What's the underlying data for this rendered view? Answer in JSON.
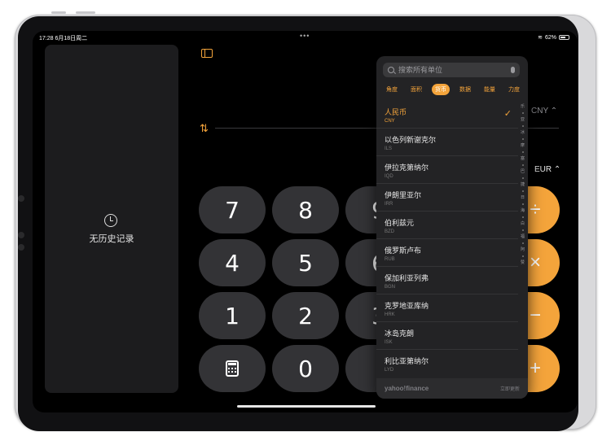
{
  "status": {
    "time": "17:28",
    "date": "6月18日周二",
    "battery": "62%",
    "dots": "•••"
  },
  "history": {
    "empty_text": "无历史记录"
  },
  "converter": {
    "from_unit": "CNY",
    "to_unit": "EUR",
    "accent_color": "#f4a43b"
  },
  "keypad": {
    "keys": [
      "7",
      "8",
      "9",
      "4",
      "5",
      "6",
      "1",
      "2",
      "3",
      "0"
    ]
  },
  "popover": {
    "search_placeholder": "搜索所有单位",
    "tabs": [
      "角度",
      "面积",
      "货币",
      "数据",
      "能量",
      "力度"
    ],
    "active_tab": "货币",
    "currencies": [
      {
        "name": "人民币",
        "code": "CNY",
        "selected": true
      },
      {
        "name": "以色列新谢克尔",
        "code": "ILS"
      },
      {
        "name": "伊拉克第纳尔",
        "code": "IQD"
      },
      {
        "name": "伊朗里亚尔",
        "code": "IRR"
      },
      {
        "name": "伯利兹元",
        "code": "BZD"
      },
      {
        "name": "俄罗斯卢布",
        "code": "RUB"
      },
      {
        "name": "保加利亚列弗",
        "code": "BGN"
      },
      {
        "name": "克罗地亚库纳",
        "code": "HRK"
      },
      {
        "name": "冰岛克朗",
        "code": "ISK"
      },
      {
        "name": "利比亚第纳尔",
        "code": "LYD"
      }
    ],
    "index_letters": [
      "乐",
      "亚",
      "冰",
      "摩",
      "塞",
      "巴",
      "捷",
      "日",
      "海",
      "白",
      "福",
      "阿",
      "赞"
    ],
    "footer_brand": "yahoo!finance",
    "footer_update": "立即更新"
  }
}
